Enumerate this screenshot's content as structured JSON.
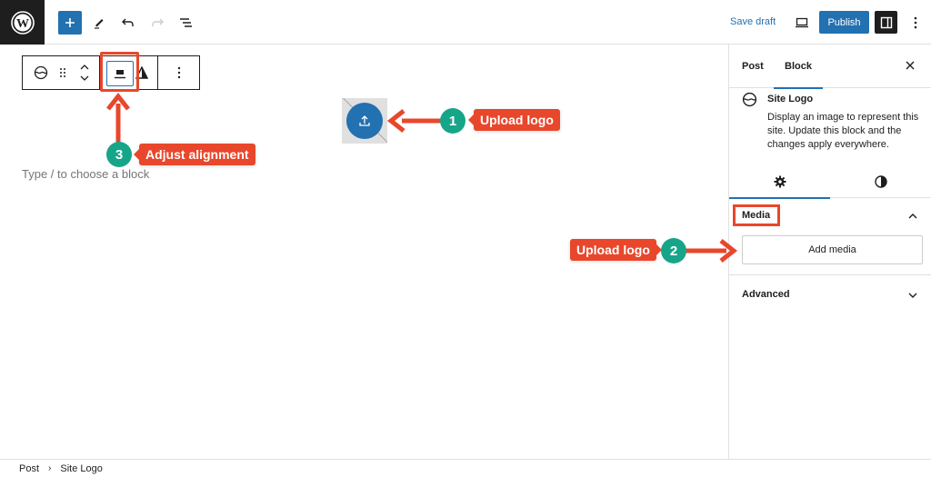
{
  "header": {
    "logo": "wordpress-logo",
    "add_block_label": "+",
    "save_draft_label": "Save draft",
    "publish_label": "Publish",
    "icons": [
      "add-icon",
      "pencil-icon",
      "undo-icon",
      "redo-icon",
      "list-view-icon",
      "desktop-preview-icon",
      "settings-icon",
      "more-options-icon"
    ]
  },
  "block_toolbar": {
    "icons": [
      "site-logo-icon",
      "drag-handle-icon",
      "move-up-icon",
      "move-down-icon",
      "align-center-icon",
      "contrast-icon",
      "more-options-icon"
    ]
  },
  "canvas": {
    "placeholder": "Type / to choose a block",
    "upload_icon": "upload-icon"
  },
  "annotations": [
    {
      "number": "1",
      "label": "Upload logo"
    },
    {
      "number": "2",
      "label": "Upload logo"
    },
    {
      "number": "3",
      "label": "Adjust alignment"
    }
  ],
  "sidebar": {
    "tabs": [
      {
        "label": "Post",
        "active": false
      },
      {
        "label": "Block",
        "active": true
      }
    ],
    "close_label": "✕",
    "block_card": {
      "title": "Site Logo",
      "description": "Display an image to represent this site. Update this block and the changes apply everywhere."
    },
    "subtabs": [
      {
        "icon": "settings-gear-icon",
        "active": true
      },
      {
        "icon": "styles-half-circle-icon",
        "active": false
      }
    ],
    "panels": [
      {
        "title": "Media",
        "expanded": true,
        "button_label": "Add media"
      },
      {
        "title": "Advanced",
        "expanded": false
      }
    ]
  },
  "footer": {
    "breadcrumb": [
      "Post",
      "Site Logo"
    ]
  },
  "colors": {
    "accent": "#2271b1",
    "annotation_red": "#e8472b",
    "annotation_teal": "#17a589",
    "dark": "#1e1e1e"
  }
}
